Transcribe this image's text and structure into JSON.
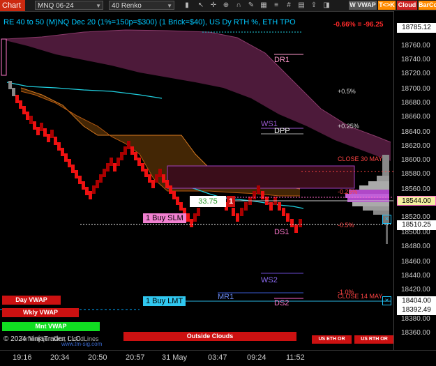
{
  "toolbar": {
    "chart_tab": "Chart",
    "instrument": "MNQ 06-24",
    "bar_type": "40 Renko",
    "icons": [
      "bar-chart-icon",
      "cursor-icon",
      "crosshair-icon",
      "zoom-icon",
      "magnet-icon",
      "draw-icon",
      "chart-type-icon",
      "properties-icon",
      "grid-icon",
      "data-box-icon",
      "share-icon",
      "screenshot-icon"
    ],
    "w_vwap": "W VWAP",
    "tk_button": "T<>K",
    "cloud_button": "Cloud",
    "barcolor_button": "BarCo",
    "colors": {
      "chart_tab": "#cc2a10",
      "t_k": "#ff8c00",
      "cloud": "#cc2222",
      "barco": "#ff8c00"
    }
  },
  "chart": {
    "header": "RE 40 to 50 (M)NQ Dec 20 (1%=150p=$300) (1 Brick=$40), US Dy RTH %, ETH TPO",
    "pnl_text": "-0.66% = -96.25",
    "level_labels": {
      "dr1": "DR1",
      "ws1": "WS1",
      "dpp": "DPP",
      "ds1": "DS1",
      "ws2": "WS2",
      "mr1": "MR1",
      "ds2": "DS2"
    },
    "pct_labels": {
      "p05": "+0.5%",
      "p025": "+0.25%",
      "m025": "-0.25%",
      "m05": "-0.5%",
      "m10": "-1.0%"
    },
    "close_labels": {
      "close_30_may": "CLOSE 30 MAY",
      "close_14_may": "CLOSE 14 MAY"
    },
    "order_buy_slm": "1 Buy SLM",
    "order_buy_lmt": "1 Buy LMT",
    "position_value": "33.75",
    "position_qty": "1",
    "cancel_symbol": "×",
    "copyright": "© 2024 NinjaTrader, LLC",
    "watermark": "TenkinKijun First CloudLines",
    "url": "www.tm-sig.com",
    "buttons": {
      "day_vwap": "Day VWAP",
      "wkly_vwap": "Wkly VWAP",
      "mnt_vwap": "Mnt VWAP",
      "outside_clouds": "Outside Clouds",
      "us_eth_or": "US ETH OR",
      "us_rth_or": "US RTH OR"
    }
  },
  "price_axis": {
    "ticks": [
      "18760.00",
      "18740.00",
      "18720.00",
      "18700.00",
      "18680.00",
      "18660.00",
      "18640.00",
      "18620.00",
      "18600.00",
      "18580.00",
      "18560.00",
      "18520.00",
      "18500.00",
      "18480.00",
      "18460.00",
      "18440.00",
      "18420.00",
      "18380.00",
      "18360.00"
    ],
    "tags": {
      "top": "18785.12",
      "current": "18544.00",
      "dotted": "18510.25",
      "lmt": "18404.00",
      "lower": "18392.49",
      "last": "18380.00"
    }
  },
  "time_axis": {
    "labels": [
      "19:16",
      "20:34",
      "20:50",
      "20:57",
      "31 May",
      "03:47",
      "09:24",
      "11:52"
    ]
  }
}
